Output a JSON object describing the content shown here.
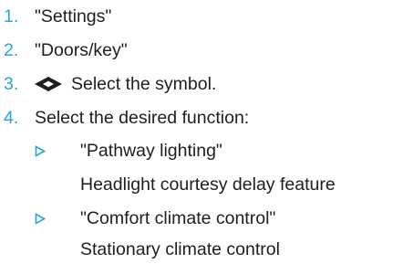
{
  "steps": [
    {
      "number": "1.",
      "text": "\"Settings\""
    },
    {
      "number": "2.",
      "text": "\"Doors/key\""
    },
    {
      "number": "3.",
      "text": "Select the symbol.",
      "icon": "diamond-symbol-icon"
    },
    {
      "number": "4.",
      "text": "Select the desired function:"
    }
  ],
  "options": [
    {
      "label": "\"Pathway lighting\"",
      "description": "Headlight courtesy delay feature"
    },
    {
      "label": "\"Comfort climate control\"",
      "description": "Stationary climate control"
    }
  ],
  "colors": {
    "accent": "#2aa6dc",
    "text": "#1e1e1e"
  }
}
